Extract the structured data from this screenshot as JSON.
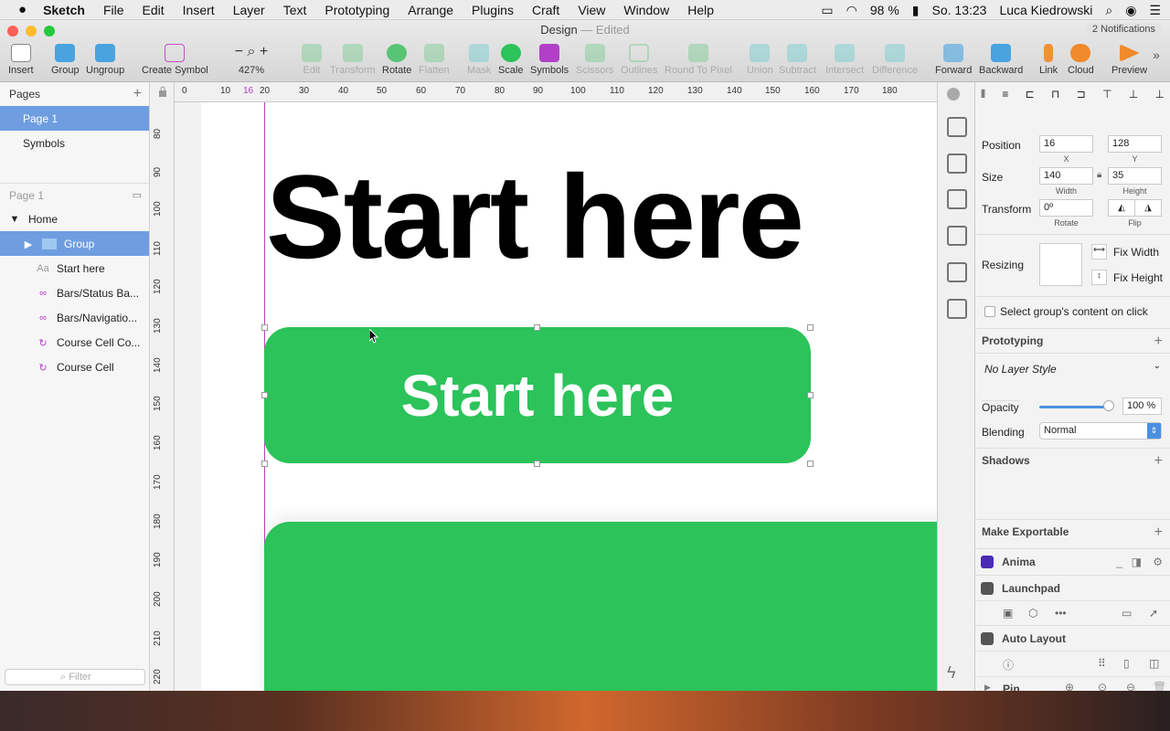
{
  "menubar": {
    "apple": "",
    "app": "Sketch",
    "items": [
      "File",
      "Edit",
      "Insert",
      "Layer",
      "Text",
      "Prototyping",
      "Arrange",
      "Plugins",
      "Craft",
      "View",
      "Window",
      "Help"
    ],
    "battery": "98 %",
    "clock": "So. 13:23",
    "user": "Luca Kiedrowski"
  },
  "window": {
    "title": "Design",
    "edited": "— Edited",
    "notifications": "2 Notifications"
  },
  "toolbar": {
    "insert": "Insert",
    "group": "Group",
    "ungroup": "Ungroup",
    "create_symbol": "Create Symbol",
    "zoom": "427%",
    "edit": "Edit",
    "transform": "Transform",
    "rotate": "Rotate",
    "flatten": "Flatten",
    "mask": "Mask",
    "scale": "Scale",
    "symbols": "Symbols",
    "scissors": "Scissors",
    "outlines": "Outlines",
    "round": "Round To Pixel",
    "union": "Union",
    "subtract": "Subtract",
    "intersect": "Intersect",
    "difference": "Difference",
    "forward": "Forward",
    "backward": "Backward",
    "link": "Link",
    "cloud": "Cloud",
    "preview": "Preview"
  },
  "pages": {
    "header": "Pages",
    "items": [
      "Page 1",
      "Symbols"
    ],
    "current_header": "Page 1"
  },
  "layers": {
    "home": "Home",
    "items": [
      "Group",
      "Start here",
      "Bars/Status Ba...",
      "Bars/Navigatio...",
      "Course Cell Co...",
      "Course Cell"
    ],
    "filter": "Filter"
  },
  "ruler": {
    "top": [
      "0",
      "10",
      "16",
      "20",
      "30",
      "40",
      "50",
      "60",
      "70",
      "80",
      "90",
      "100",
      "110",
      "120",
      "130",
      "140",
      "150",
      "160",
      "170",
      "180"
    ],
    "left": [
      "80",
      "90",
      "100",
      "110",
      "120",
      "130",
      "140",
      "150",
      "160",
      "170",
      "180",
      "190",
      "200",
      "210",
      "220"
    ]
  },
  "canvas": {
    "title": "Start here",
    "button_label": "Start here",
    "colors": {
      "green": "#2bc35a",
      "guide": "#c040c0"
    }
  },
  "inspector": {
    "position_label": "Position",
    "x": "16",
    "y": "128",
    "x_label": "X",
    "y_label": "Y",
    "size_label": "Size",
    "width": "140",
    "height": "35",
    "width_label": "Width",
    "height_label": "Height",
    "transform_label": "Transform",
    "rotate": "0º",
    "rotate_label": "Rotate",
    "flip_label": "Flip",
    "resizing_label": "Resizing",
    "fix_width": "Fix Width",
    "fix_height": "Fix Height",
    "select_group": "Select group's content on click",
    "prototyping": "Prototyping",
    "layer_style": "No Layer Style",
    "opacity_label": "Opacity",
    "opacity": "100 %",
    "blending_label": "Blending",
    "blending": "Normal",
    "shadows": "Shadows",
    "make_exportable": "Make Exportable",
    "plugins": [
      "Anima",
      "Launchpad",
      "Auto Layout"
    ],
    "pin": "Pin"
  }
}
